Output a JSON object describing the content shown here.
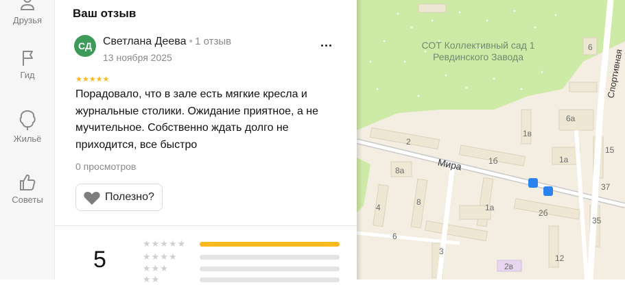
{
  "rail": {
    "items": [
      {
        "label": "Друзья",
        "icon": "friends-icon"
      },
      {
        "label": "Гид",
        "icon": "flag-icon"
      },
      {
        "label": "Жильё",
        "icon": "housing-icon"
      },
      {
        "label": "Советы",
        "icon": "thumbs-up-icon"
      }
    ]
  },
  "review": {
    "section_title": "Ваш отзыв",
    "avatar_initials": "СД",
    "author_name": "Светлана Деева",
    "author_reviews": "1 отзыв",
    "date": "13 ноября 2025",
    "stars": 5,
    "stars_text": "★★★★★",
    "text": "Порадовало, что в зале есть мягкие кресла и журнальные столики. Ожидание приятное, а не мучительное. Собственно ждать долго не приходится, все быстро",
    "views": "0 просмотров",
    "useful_label": "Полезно?"
  },
  "summary": {
    "rating": "5",
    "rows": [
      {
        "stars": "★★★★★",
        "fraction": 1.0
      },
      {
        "stars": "★★★★",
        "fraction": 0.0
      },
      {
        "stars": "★★★",
        "fraction": 0.0
      },
      {
        "stars": "★★",
        "fraction": 0.0
      }
    ]
  },
  "map": {
    "area_label": "СОТ Коллективный сад 1 Ревдинского Завода",
    "street_mira": "Мира",
    "street_sport": "Спортивная",
    "houses": [
      "6",
      "2",
      "1в",
      "6а",
      "15",
      "8а",
      "1б",
      "1а",
      "37",
      "4",
      "8",
      "2б",
      "35",
      "1а",
      "6",
      "3",
      "12",
      "2в"
    ]
  }
}
